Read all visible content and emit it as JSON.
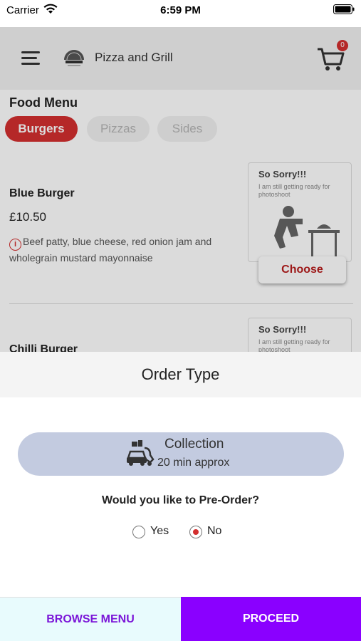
{
  "status_bar": {
    "carrier": "Carrier",
    "time": "6:59 PM"
  },
  "header": {
    "store_name": "Pizza and Grill",
    "cart_count": "0"
  },
  "menu": {
    "title": "Food Menu",
    "categories": [
      {
        "label": "Burgers",
        "active": true
      },
      {
        "label": "Pizzas",
        "active": false
      },
      {
        "label": "Sides",
        "active": false
      }
    ],
    "items": [
      {
        "name": "Blue Burger",
        "price": "£10.50",
        "description": "Beef patty, blue cheese, red onion jam and wholegrain mustard mayonnaise",
        "placeholder_title": "So Sorry!!!",
        "placeholder_sub": "I am still getting ready for photoshoot",
        "choose_label": "Choose"
      },
      {
        "name": "Chilli Burger",
        "placeholder_title": "So Sorry!!!",
        "placeholder_sub": "I am still getting ready for photoshoot"
      }
    ]
  },
  "order_sheet": {
    "title": "Order Type",
    "collection_label": "Collection",
    "collection_time": "20 min approx",
    "preorder_question": "Would you like to Pre-Order?",
    "options": [
      {
        "label": "Yes",
        "selected": false
      },
      {
        "label": "No",
        "selected": true
      }
    ]
  },
  "footer": {
    "browse_label": "BROWSE MENU",
    "proceed_label": "PROCEED"
  },
  "colors": {
    "accent_red": "#d32f2f",
    "purple": "#8a00ff",
    "collection_bg": "#c3cbe0"
  }
}
